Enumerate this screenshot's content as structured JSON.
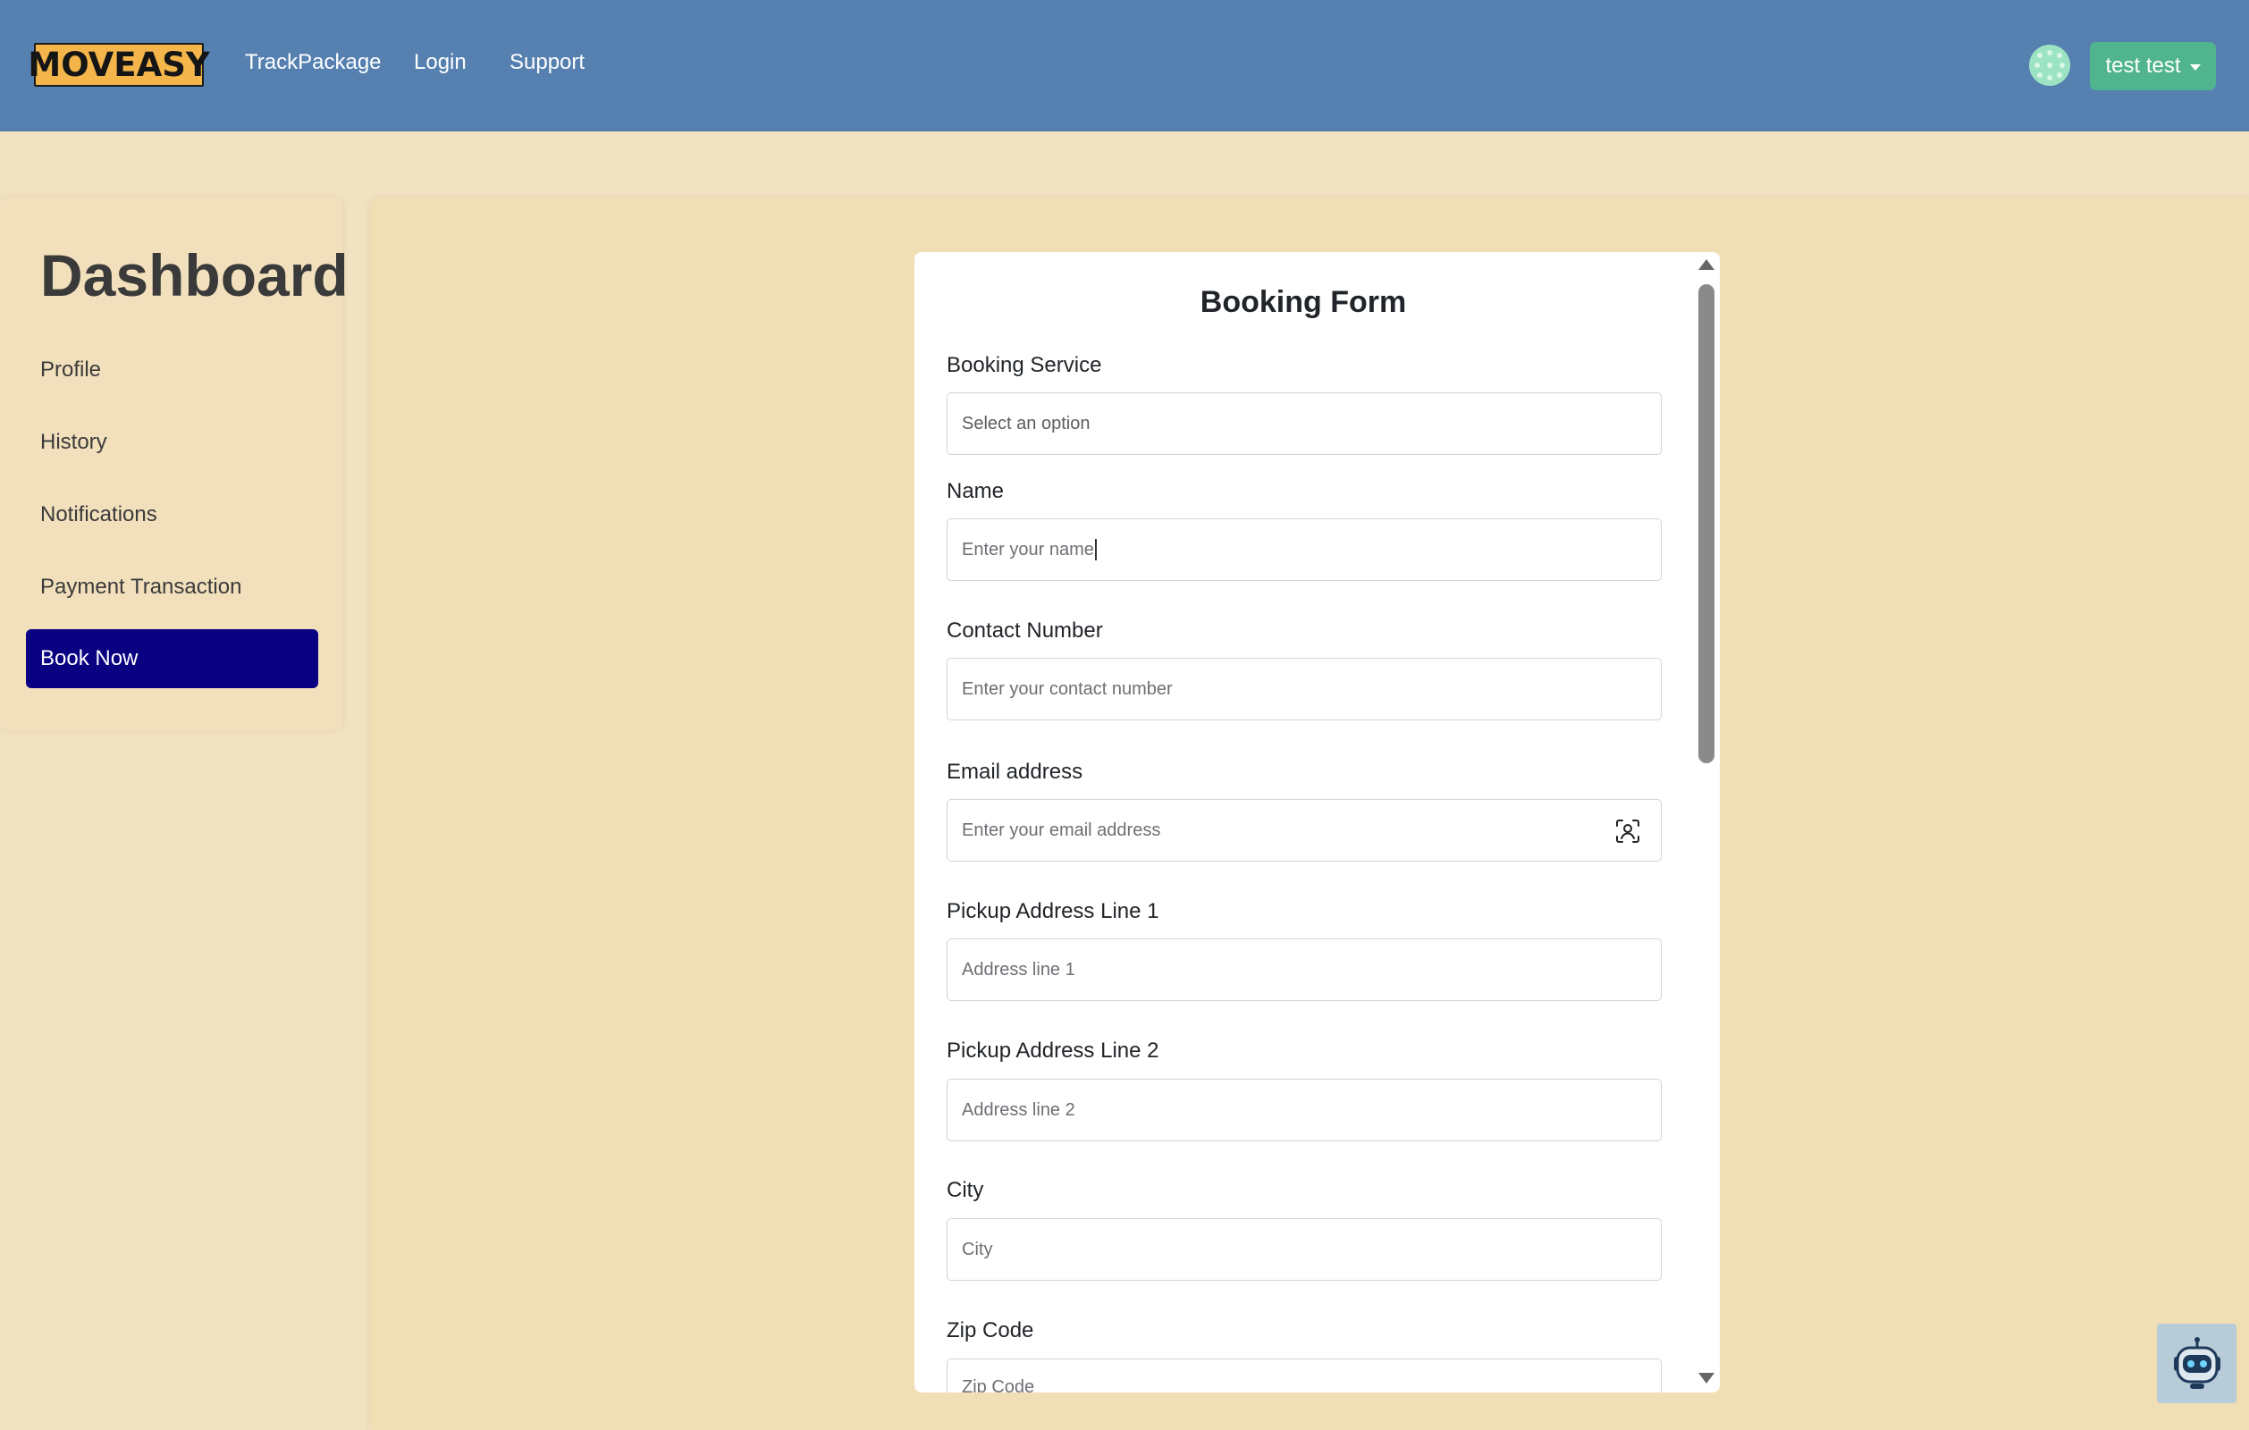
{
  "brand": {
    "logo_text": "MOVEASY"
  },
  "nav": {
    "links": [
      "TrackPackage",
      "Login",
      "Support"
    ],
    "user_button": "test test"
  },
  "sidebar": {
    "title": "Dashboard",
    "items": [
      "Profile",
      "History",
      "Notifications",
      "Payment Transaction"
    ],
    "active_item": "Book Now"
  },
  "form": {
    "title": "Booking Form",
    "fields": [
      {
        "label": "Booking Service",
        "value": "Select an option"
      },
      {
        "label": "Name",
        "placeholder": "Enter your name"
      },
      {
        "label": "Contact Number",
        "placeholder": "Enter your contact number"
      },
      {
        "label": "Email address",
        "placeholder": "Enter your email address"
      },
      {
        "label": "Pickup Address Line 1",
        "placeholder": "Address line 1"
      },
      {
        "label": "Pickup Address Line 2",
        "placeholder": "Address line 2"
      },
      {
        "label": "City",
        "placeholder": "City"
      },
      {
        "label": "Zip Code",
        "placeholder": "Zip Code"
      }
    ]
  },
  "colors": {
    "navbar": "#5580b0",
    "page_bg": "#f1e2c2",
    "active_item_bg": "#0a0082",
    "user_button_bg": "#50b48e",
    "logo_bg": "#f4b64a"
  },
  "icons": {
    "email_field_icon": "contact-autofill-icon",
    "chatbot": "robot-icon",
    "user_caret": "caret-down-icon"
  }
}
